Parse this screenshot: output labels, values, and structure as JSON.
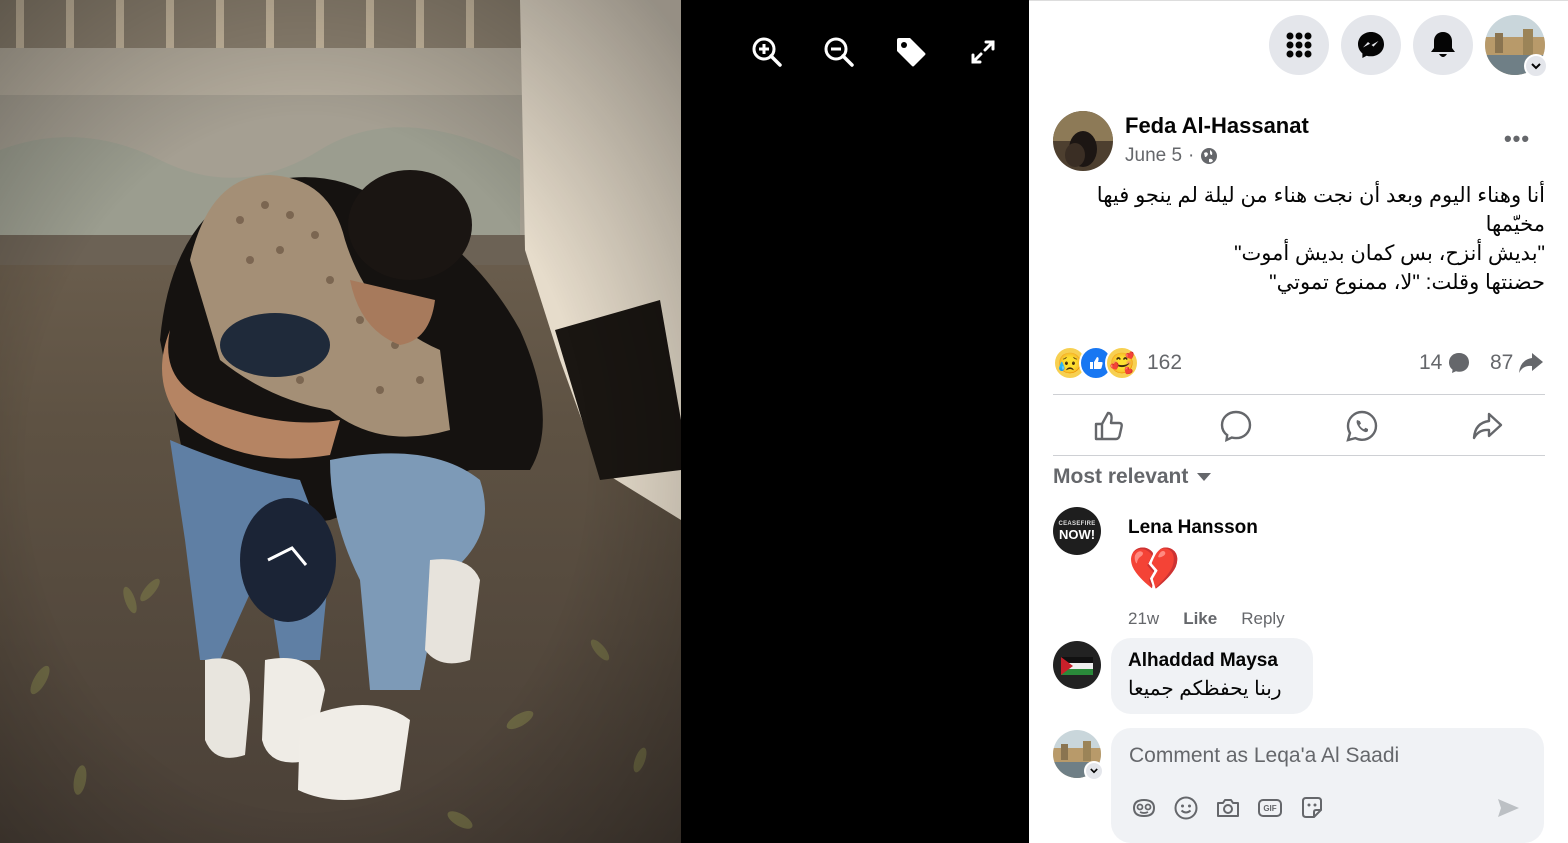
{
  "viewer": {
    "tools": [
      "zoom-in",
      "zoom-out",
      "tag",
      "fullscreen"
    ]
  },
  "topbar": {
    "icons": [
      "menu-grid-icon",
      "messenger-icon",
      "notifications-icon",
      "account-avatar"
    ]
  },
  "post": {
    "author": "Feda Al-Hassanat",
    "date": "June 5",
    "date_sep": "·",
    "more": "•••",
    "text_lines": [
      "أنا وهناء اليوم وبعد أن نجت هناء من ليلة لم ينجو فيها",
      "مخيّمها",
      "\"بديش أنزح، بس كمان بديش أموت\"",
      "حضنتها وقلت: \"لا، ممنوع تموتي\""
    ],
    "reactions": {
      "emojis": [
        "😥",
        "👍",
        "🥰"
      ],
      "count": "162"
    },
    "comments_count": "14",
    "shares_count": "87"
  },
  "actions": [
    "like",
    "comment",
    "whatsapp-share",
    "share"
  ],
  "comments_section": {
    "sort_label": "Most relevant",
    "comments": [
      {
        "author": "Lena Hansson",
        "text": "💔",
        "time": "21w",
        "like": "Like",
        "reply": "Reply",
        "avatar_text_top": "CEASEFIRE",
        "avatar_text_bottom": "NOW!"
      },
      {
        "author": "Alhaddad Maysa",
        "text": "ربنا يحفظكم جميعا"
      }
    ],
    "composer": {
      "placeholder": "Comment as Leqa'a Al Saadi",
      "gif_label": "GIF"
    }
  },
  "colors": {
    "accent": "#1877f2",
    "muted": "#65676b",
    "bubble": "#f0f2f5",
    "viewer_bg": "#000000"
  }
}
